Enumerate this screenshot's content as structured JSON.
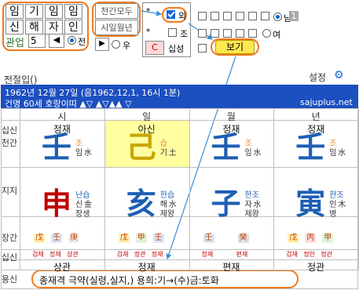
{
  "controls": {
    "chars_grid": [
      "임",
      "기",
      "임",
      "임",
      "신",
      "해",
      "자",
      "인"
    ],
    "tab_label": "관업",
    "input_value": "5",
    "radio_label": "전",
    "btn_cheongan_modu": "천간모두",
    "btn_sihil": "시일월년",
    "radio_u": "우",
    "star1": "*",
    "star2": "*",
    "check_oe": "외",
    "check_jo": "조",
    "btn_c": "C",
    "btn_sipsung": "십성",
    "radio_nam": "남",
    "nam_box": "1",
    "radio_yeo": "여",
    "btn_bogi": "보기"
  },
  "info": {
    "left_label": "전절입()",
    "settings": "설정",
    "date_line": "1962년 12월 27일 (음1962,12,1, 16시 1분)",
    "sub_line": "건명 60세 호랑이띠  ▲▽   ▲▽▲▲   ▽",
    "site": "sajuplus.net"
  },
  "pillars": {
    "header": [
      "시",
      "일",
      "월",
      "년"
    ],
    "row_sipsin_top": [
      "정재",
      "아신",
      "정재",
      "정재"
    ],
    "row_labels": [
      "십신",
      "천간",
      "지지",
      "장간",
      "십신",
      "용신"
    ],
    "stems": [
      {
        "char": "壬",
        "top": "조",
        "hanja": "임",
        "elem": "水",
        "color": "#1e5fb4"
      },
      {
        "char": "己",
        "top": "습",
        "hanja": "기",
        "elem": "土",
        "color": "#c9a500"
      },
      {
        "char": "壬",
        "top": "조",
        "hanja": "임",
        "elem": "水",
        "color": "#1e5fb4"
      },
      {
        "char": "壬",
        "top": "조",
        "hanja": "임",
        "elem": "水",
        "color": "#1e5fb4"
      }
    ],
    "branches": [
      {
        "char": "申",
        "top": "난습",
        "mid": "신",
        "elem": "金",
        "bottom": "장생",
        "color": "#c00000"
      },
      {
        "char": "亥",
        "top": "한습",
        "mid": "해",
        "elem": "水",
        "bottom": "제왕",
        "color": "#1e5fb4"
      },
      {
        "char": "子",
        "top": "한조",
        "mid": "자",
        "elem": "水",
        "bottom": "제왕",
        "color": "#1e5fb4"
      },
      {
        "char": "寅",
        "top": "한조",
        "mid": "인",
        "elem": "木",
        "bottom": "병",
        "color": "#1e5fb4"
      }
    ],
    "janggan": [
      {
        "chars": [
          "戊",
          "壬",
          "庚"
        ],
        "labels": [
          "검재",
          "정재",
          "상관"
        ]
      },
      {
        "chars": [
          "戊",
          "甲",
          "壬"
        ],
        "labels": [
          "검재",
          "정관",
          "정재"
        ]
      },
      {
        "chars": [
          "壬",
          "",
          "癸"
        ],
        "labels": [
          "정재",
          "",
          "편재"
        ]
      },
      {
        "chars": [
          "戊",
          "丙",
          "甲"
        ],
        "labels": [
          "검재",
          "정인",
          "정관"
        ]
      }
    ],
    "row_sipsin_bottom": [
      "상관",
      "정재",
      "편재",
      "정관"
    ],
    "yongsin": "종재격 극약(실령,실지,)  용희:기→(수)금:토화"
  },
  "colors": {
    "accent": "#f07a1e",
    "header_bar": "#1c4fc0",
    "yellow": "#ffffa0",
    "blue_text": "#1e5fb4"
  }
}
